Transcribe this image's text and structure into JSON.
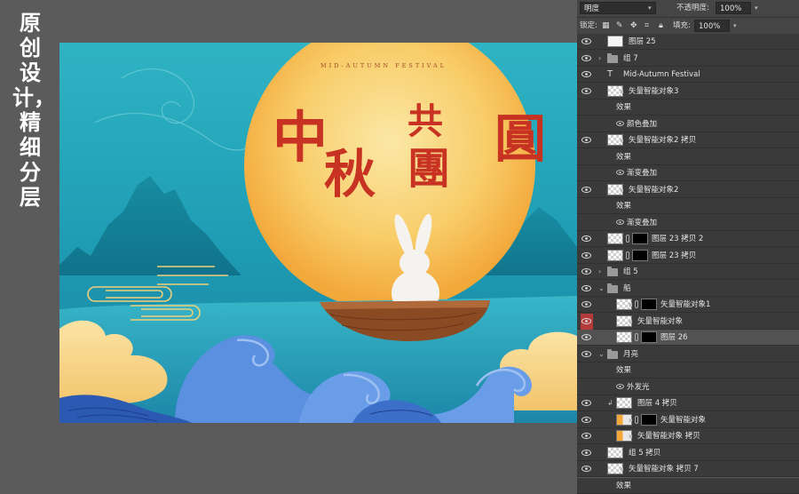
{
  "side_caption": "原创设计，精细分层",
  "artwork": {
    "subtitle": "MID-AUTUMN FESTIVAL",
    "title_chars": [
      "中",
      "秋",
      "共",
      "團",
      "圓"
    ]
  },
  "toolbar": {
    "blend_mode": "明度",
    "opacity_label": "不透明度:",
    "opacity_value": "100%",
    "lock_label": "锁定:",
    "fill_label": "填充:",
    "fill_value": "100%"
  },
  "layers": [
    {
      "name": "图层 25",
      "kind": "layer",
      "indent": 0,
      "thumb": "white"
    },
    {
      "name": "组 7",
      "kind": "group",
      "indent": 0
    },
    {
      "name": "Mid-Autumn Festival",
      "kind": "text",
      "indent": 0
    },
    {
      "name": "矢量智能对象3",
      "kind": "smart",
      "indent": 0
    },
    {
      "name": "效果",
      "kind": "fx",
      "indent": 1
    },
    {
      "name": "颜色叠加",
      "kind": "effect",
      "indent": 2
    },
    {
      "name": "矢量智能对象2 拷贝",
      "kind": "smart",
      "indent": 0
    },
    {
      "name": "效果",
      "kind": "fx",
      "indent": 1
    },
    {
      "name": "渐变叠加",
      "kind": "effect",
      "indent": 2
    },
    {
      "name": "矢量智能对象2",
      "kind": "smart",
      "indent": 0
    },
    {
      "name": "效果",
      "kind": "fx",
      "indent": 1
    },
    {
      "name": "渐变叠加",
      "kind": "effect",
      "indent": 2
    },
    {
      "name": "图层 23 拷贝 2",
      "kind": "masked",
      "indent": 0
    },
    {
      "name": "图层 23 拷贝",
      "kind": "masked",
      "indent": 0
    },
    {
      "name": "组 5",
      "kind": "group",
      "indent": 0
    },
    {
      "name": "船",
      "kind": "group-open",
      "indent": 0
    },
    {
      "name": "矢量智能对象1",
      "kind": "masked-smart",
      "indent": 1
    },
    {
      "name": "矢量智能对象",
      "kind": "smart",
      "indent": 1,
      "eye": "red"
    },
    {
      "name": "图层 26",
      "kind": "masked",
      "indent": 1,
      "selected": true
    },
    {
      "name": "月亮",
      "kind": "group-open",
      "indent": 0
    },
    {
      "name": "效果",
      "kind": "fx",
      "indent": 1
    },
    {
      "name": "外发光",
      "kind": "effect",
      "indent": 2
    },
    {
      "name": "图层 4 拷贝",
      "kind": "clip",
      "indent": 1
    },
    {
      "name": "矢量智能对象",
      "kind": "masked-smart",
      "indent": 1,
      "thumb": "orange"
    },
    {
      "name": "矢量智能对象 拷贝",
      "kind": "smart",
      "indent": 1,
      "thumb": "orange"
    },
    {
      "name": "组 5 拷贝",
      "kind": "layer",
      "indent": 0
    },
    {
      "name": "矢量智能对象 拷贝 7",
      "kind": "smart",
      "indent": 0
    },
    {
      "name": "效果",
      "kind": "fx",
      "indent": 1
    }
  ],
  "colors": {
    "sky_top": "#2fb4c4",
    "sky_bottom": "#1a7fa0",
    "moon_center": "#fbe6a0",
    "moon_edge": "#f4a838",
    "title_red": "#c73222",
    "boat_wood": "#8a4a24",
    "wave_blue": "#5b8fe0",
    "panel_bg": "#3a3a3a"
  }
}
